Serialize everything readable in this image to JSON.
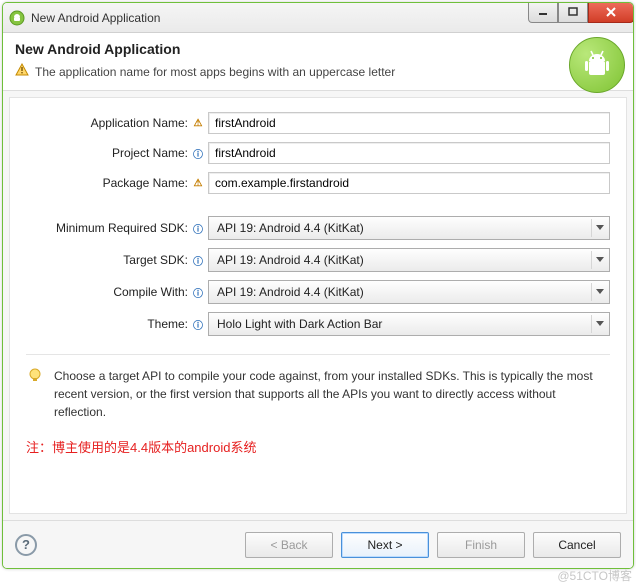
{
  "window": {
    "title": "New Android Application"
  },
  "header": {
    "title": "New Android Application",
    "warning": "The application name for most apps begins with an uppercase letter"
  },
  "form": {
    "app_name": {
      "label": "Application Name:",
      "value": "firstAndroid"
    },
    "project_name": {
      "label": "Project Name:",
      "value": "firstAndroid"
    },
    "package_name": {
      "label": "Package Name:",
      "value": "com.example.firstandroid"
    },
    "min_sdk": {
      "label": "Minimum Required SDK:",
      "value": "API 19: Android 4.4 (KitKat)"
    },
    "target_sdk": {
      "label": "Target SDK:",
      "value": "API 19: Android 4.4 (KitKat)"
    },
    "compile_with": {
      "label": "Compile With:",
      "value": "API 19: Android 4.4 (KitKat)"
    },
    "theme": {
      "label": "Theme:",
      "value": "Holo Light with Dark Action Bar"
    }
  },
  "tip": "Choose a target API to compile your code against, from your installed SDKs. This is typically the most recent version, or the first version that supports all the APIs you want to directly access without reflection.",
  "note_red": "注：博主使用的是4.4版本的android系统",
  "footer": {
    "back": "< Back",
    "next": "Next >",
    "finish": "Finish",
    "cancel": "Cancel"
  },
  "watermark": "@51CTO博客"
}
